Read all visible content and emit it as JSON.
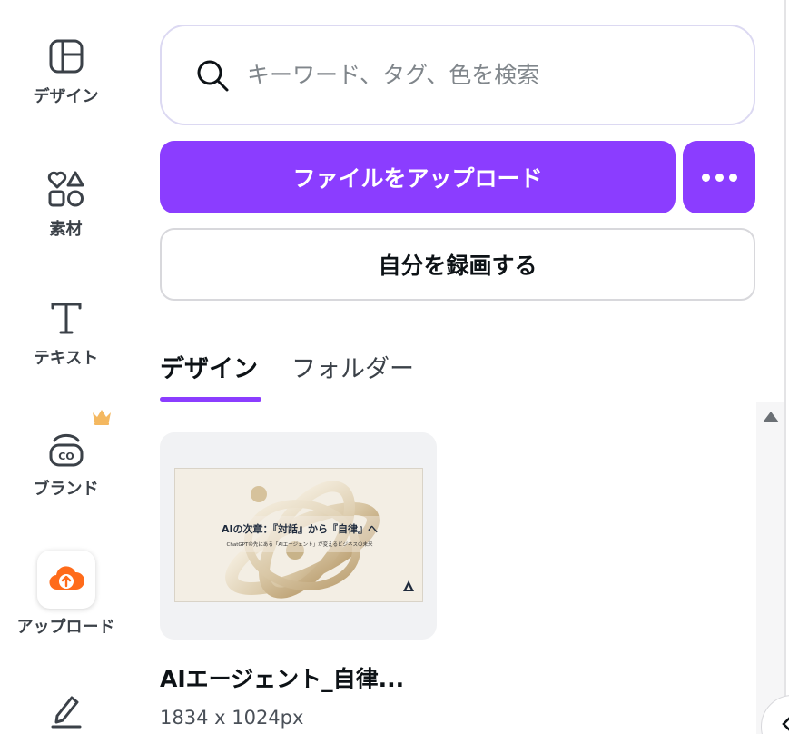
{
  "sidebar": {
    "items": [
      {
        "label": "デザイン",
        "icon": "layout-icon"
      },
      {
        "label": "素材",
        "icon": "elements-icon"
      },
      {
        "label": "テキスト",
        "icon": "text-icon"
      },
      {
        "label": "ブランド",
        "icon": "brand-icon"
      },
      {
        "label": "アップロード",
        "icon": "upload-cloud-icon"
      },
      {
        "label": "",
        "icon": "draw-icon"
      }
    ],
    "active": "アップロード",
    "premium_badge": "crown-icon"
  },
  "search": {
    "placeholder": "キーワード、タグ、色を検索",
    "value": ""
  },
  "actions": {
    "upload_label": "ファイルをアップロード",
    "more_icon": "more-horizontal-icon",
    "record_label": "自分を録画する"
  },
  "tabs": [
    {
      "label": "デザイン",
      "active": true
    },
    {
      "label": "フォルダー",
      "active": false
    }
  ],
  "designs": [
    {
      "name": "AIエージェント_自律...",
      "size": "1834 x 1024px",
      "thumbnail": {
        "title": "AIの次章：『対話』から『自律』へ",
        "subtitle": "ChatGPTの先にある「AIエージェント」が変えるビジネスの未来"
      }
    }
  ],
  "colors": {
    "accent": "#8b3dff",
    "upload_icon": "#ff6b1a",
    "crown": "#f4b860",
    "text": "#0d1216"
  }
}
